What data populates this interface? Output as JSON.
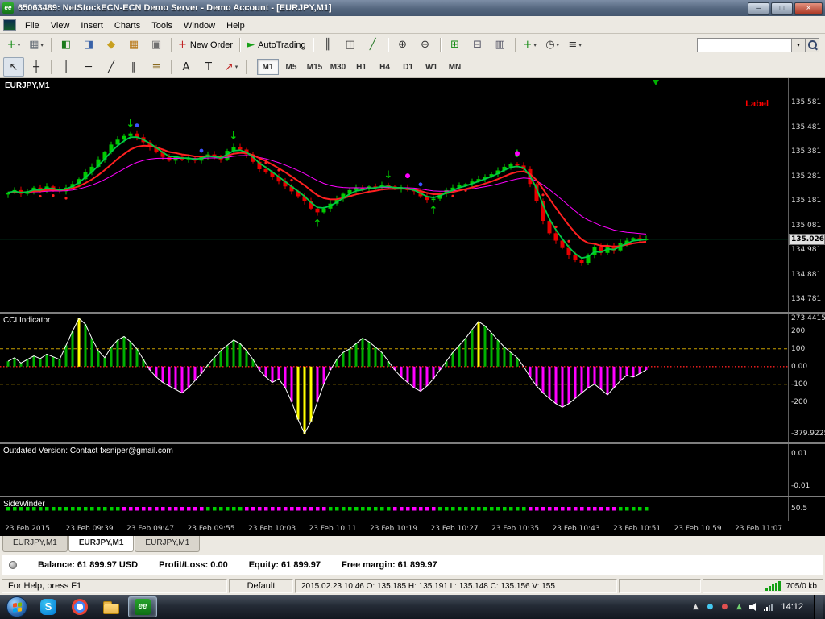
{
  "window": {
    "title": "65063489: NetStockECN-ECN Demo Server - Demo Account - [EURJPY,M1]",
    "app_icon_text": "ee"
  },
  "icons": {
    "minimize": "─",
    "maximize": "□",
    "close": "×",
    "caret": "▾",
    "tray-up": "▲"
  },
  "menu": {
    "items": [
      "File",
      "View",
      "Insert",
      "Charts",
      "Tools",
      "Window",
      "Help"
    ]
  },
  "toolbar1": {
    "search_value": "",
    "buttons": [
      {
        "name": "new-chart",
        "glyph": "+",
        "color": "#128a12",
        "caret": true
      },
      {
        "name": "profiles",
        "glyph": "▦",
        "color": "#666e78",
        "caret": true
      },
      {
        "sep": true
      },
      {
        "name": "market-watch",
        "glyph": "◧",
        "color": "#1a7a1a"
      },
      {
        "name": "data-window",
        "glyph": "◨",
        "color": "#3a62a8"
      },
      {
        "name": "navigator",
        "glyph": "◆",
        "color": "#c8a020"
      },
      {
        "name": "terminal",
        "glyph": "▦",
        "color": "#b87818"
      },
      {
        "name": "strategy-tester",
        "glyph": "▣",
        "color": "#707070"
      },
      {
        "sep": true
      },
      {
        "name": "new-order",
        "glyph": "+",
        "color": "#c02020",
        "label": "New Order"
      },
      {
        "sep": true
      },
      {
        "name": "autotrading",
        "glyph": "►",
        "color": "#18a018",
        "label": "AutoTrading"
      },
      {
        "sep": true
      },
      {
        "name": "chart-bars",
        "glyph": "║",
        "color": "#333333"
      },
      {
        "name": "chart-candles",
        "glyph": "◫",
        "color": "#333333"
      },
      {
        "name": "chart-line",
        "glyph": "╱",
        "color": "#2a7a2a"
      },
      {
        "sep": true
      },
      {
        "name": "zoom-in",
        "glyph": "⊕",
        "color": "#333333"
      },
      {
        "name": "zoom-out",
        "glyph": "⊖",
        "color": "#333333"
      },
      {
        "sep": true
      },
      {
        "name": "tile-windows",
        "glyph": "⊞",
        "color": "#128a12"
      },
      {
        "name": "cascade-windows",
        "glyph": "⊟",
        "color": "#555566"
      },
      {
        "name": "arrange-icons",
        "glyph": "▥",
        "color": "#555566"
      },
      {
        "sep": true
      },
      {
        "name": "indicators",
        "glyph": "+",
        "color": "#128a12",
        "caret": true
      },
      {
        "name": "periods",
        "glyph": "◷",
        "color": "#333333",
        "caret": true
      },
      {
        "name": "templates",
        "glyph": "≡",
        "color": "#333333",
        "caret": true
      }
    ]
  },
  "toolbar2": {
    "tools": [
      {
        "name": "cursor",
        "glyph": "↖",
        "color": "#222222",
        "active": true
      },
      {
        "name": "crosshair",
        "glyph": "┼",
        "color": "#222222"
      },
      {
        "sep": true
      },
      {
        "name": "vertical-line",
        "glyph": "│",
        "color": "#222222"
      },
      {
        "name": "horizontal-line",
        "glyph": "─",
        "color": "#222222"
      },
      {
        "name": "trendline",
        "glyph": "╱",
        "color": "#222222"
      },
      {
        "name": "equidistant-channel",
        "glyph": "∥",
        "color": "#222222"
      },
      {
        "name": "fibonacci",
        "glyph": "≡",
        "color": "#8a6a20"
      },
      {
        "sep": true
      },
      {
        "name": "text",
        "glyph": "A",
        "color": "#222222"
      },
      {
        "name": "text-label",
        "glyph": "T",
        "color": "#222222"
      },
      {
        "name": "arrows-tool",
        "glyph": "↗",
        "color": "#c02020",
        "caret": true
      },
      {
        "sep": true
      }
    ]
  },
  "timeframes": [
    "M1",
    "M5",
    "M15",
    "M30",
    "H1",
    "H4",
    "D1",
    "W1",
    "MN"
  ],
  "active_timeframe": "M1",
  "chart": {
    "symbol_label": "EURJPY,M1",
    "corner_label": "Label",
    "price_scale": [
      "135.581",
      "135.481",
      "135.381",
      "135.281",
      "135.181",
      "135.081",
      "134.981",
      "134.881",
      "134.781"
    ],
    "current_price": "135.026",
    "cci": {
      "label": "CCI Indicator",
      "scale": [
        "273.4415",
        "200",
        "100",
        "0.00",
        "-100",
        "-200",
        "-379.9225"
      ]
    },
    "outdated": {
      "label": "Outdated Version: Contact fxsniper@gmail.com",
      "scale": [
        "0.01",
        "-0.01"
      ]
    },
    "sidewinder": {
      "label": "SideWinder",
      "scale": [
        "50.5"
      ]
    },
    "time_axis": [
      "23 Feb 2015",
      "23 Feb 09:39",
      "23 Feb 09:47",
      "23 Feb 09:55",
      "23 Feb 10:03",
      "23 Feb 10:11",
      "23 Feb 10:19",
      "23 Feb 10:27",
      "23 Feb 10:35",
      "23 Feb 10:43",
      "23 Feb 10:51",
      "23 Feb 10:59",
      "23 Feb 11:07"
    ]
  },
  "colors": {
    "bull": "#00cc00",
    "bear": "#e80000",
    "ma_fast": "#ff2020",
    "ma_slow": "#00cc44",
    "band": "#ff00ff",
    "cci_pos": "#00b000",
    "cci_neg": "#ff00ff",
    "cci_extreme": "#ffff00",
    "level": "#c8a000",
    "zero_line": "#ff2020",
    "current_price_line": "#00a35a"
  },
  "chart_data": {
    "type": "candlestick+histogram",
    "symbol": "EURJPY",
    "timeframe": "M1",
    "current_price": 135.026,
    "price_range": [
      134.73,
      135.68
    ],
    "cci_range": [
      -430,
      300
    ],
    "closes": [
      135.215,
      135.225,
      135.21,
      135.22,
      135.235,
      135.225,
      135.24,
      135.23,
      135.22,
      135.235,
      135.25,
      135.27,
      135.3,
      135.32,
      135.35,
      135.38,
      135.41,
      135.43,
      135.445,
      135.455,
      135.44,
      135.42,
      135.4,
      135.38,
      135.36,
      135.345,
      135.36,
      135.35,
      135.355,
      135.345,
      135.36,
      135.37,
      135.36,
      135.35,
      135.385,
      135.4,
      135.39,
      135.37,
      135.34,
      135.31,
      135.3,
      135.28,
      135.26,
      135.24,
      135.22,
      135.2,
      135.18,
      135.15,
      135.135,
      135.15,
      135.17,
      135.19,
      135.21,
      135.225,
      135.235,
      135.23,
      135.24,
      135.235,
      135.245,
      135.24,
      135.23,
      135.235,
      135.225,
      135.22,
      135.2,
      135.185,
      135.19,
      135.21,
      135.225,
      135.235,
      135.245,
      135.25,
      135.26,
      135.27,
      135.28,
      135.29,
      135.305,
      135.32,
      135.33,
      135.325,
      135.31,
      135.25,
      135.18,
      135.1,
      135.05,
      135.02,
      134.99,
      134.96,
      134.94,
      134.93,
      134.96,
      134.995,
      134.97,
      135.0,
      134.98,
      135.01,
      135.02,
      135.03,
      135.025,
      135.026
    ],
    "cci": [
      30,
      50,
      20,
      40,
      60,
      45,
      70,
      55,
      40,
      120,
      200,
      273,
      240,
      160,
      90,
      50,
      110,
      150,
      170,
      140,
      100,
      40,
      -20,
      -60,
      -90,
      -110,
      -130,
      -150,
      -120,
      -80,
      -40,
      10,
      50,
      90,
      120,
      150,
      130,
      90,
      40,
      -20,
      -60,
      -90,
      -70,
      -120,
      -200,
      -300,
      -380,
      -310,
      -200,
      -100,
      -20,
      40,
      80,
      100,
      130,
      160,
      140,
      110,
      80,
      30,
      -20,
      -60,
      -90,
      -120,
      -140,
      -110,
      -70,
      -20,
      30,
      80,
      120,
      160,
      210,
      255,
      230,
      190,
      150,
      110,
      80,
      50,
      0,
      -60,
      -110,
      -150,
      -180,
      -210,
      -230,
      -210,
      -180,
      -150,
      -120,
      -100,
      -130,
      -160,
      -120,
      -80,
      -50,
      -60,
      -40,
      -20
    ],
    "sidewinder": "ggggggggggggggggggmmmmmmmmmmmmmggggggmmmmmmmmmmmmmggggggggggmmmmmmmggggggggggggggmmmmmmmmmmmmmmggggg",
    "signals": {
      "down": [
        19,
        35,
        59,
        79
      ],
      "up": [
        48,
        66
      ]
    },
    "dots": {
      "blue": [
        20,
        30,
        64
      ],
      "magenta": [
        62,
        79
      ],
      "red_below": [
        5,
        7,
        9,
        69,
        71
      ],
      "red_above": [
        40,
        42,
        44,
        83,
        85,
        87
      ]
    }
  },
  "tabs": [
    "EURJPY,M1",
    "EURJPY,M1",
    "EURJPY,M1"
  ],
  "active_tab": 1,
  "terminal": {
    "balance": "Balance: 61 899.97 USD",
    "profit": "Profit/Loss: 0.00",
    "equity": "Equity: 61 899.97",
    "free_margin": "Free margin: 61 899.97"
  },
  "status": {
    "help": "For Help, press F1",
    "profile": "Default",
    "quote": "2015.02.23 10:46  O: 135.185  H: 135.191  L: 135.148  C: 135.156  V: 155",
    "traffic": "705/0 kb"
  },
  "taskbar": {
    "clock": "14:12",
    "skype_letter": "S",
    "mt_icon_text": "ee",
    "tray_icons": [
      {
        "name": "tray-app-1",
        "glyph": "●",
        "color": "#44c8f0"
      },
      {
        "name": "tray-app-2",
        "glyph": "●",
        "color": "#e05050"
      },
      {
        "name": "tray-app-3",
        "glyph": "▲",
        "color": "#70d070"
      }
    ]
  }
}
